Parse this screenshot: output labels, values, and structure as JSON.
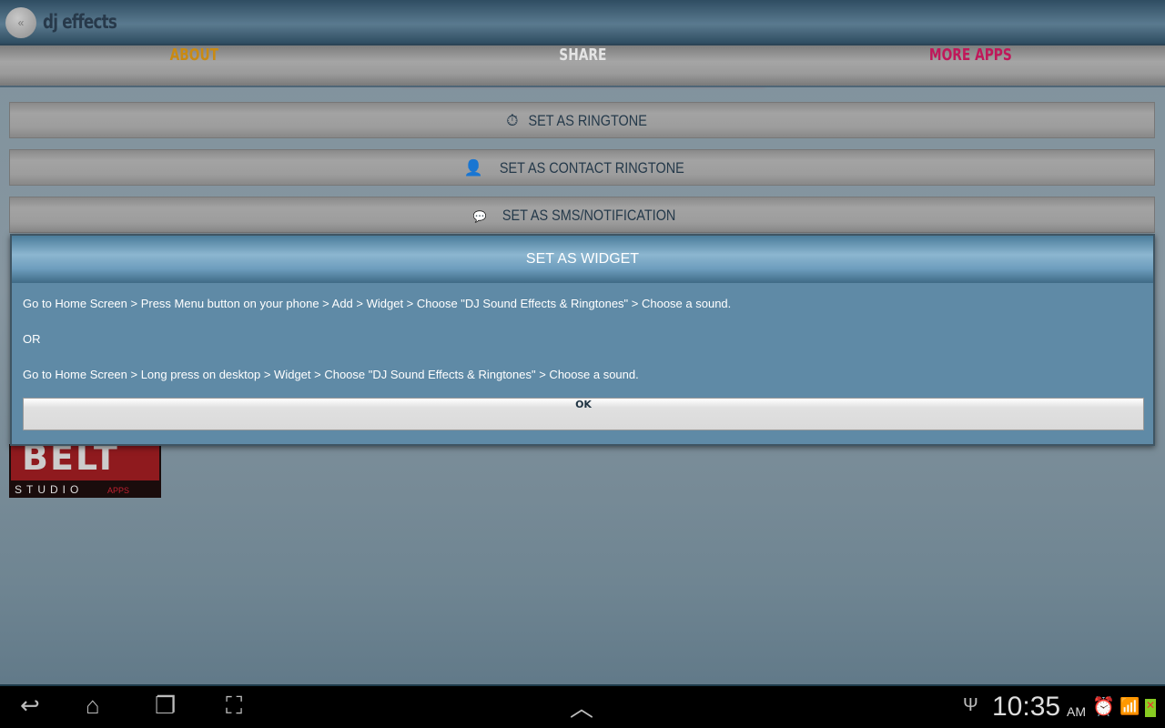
{
  "app": {
    "title": "dj effects"
  },
  "tabs": [
    {
      "label": "ABOUT",
      "color": "#c98a12"
    },
    {
      "label": "SHARE",
      "color": "#e4e4e4"
    },
    {
      "label": "MORE APPS",
      "color": "#c0185a"
    }
  ],
  "actions": [
    {
      "label": "SET AS RINGTONE",
      "icon": "stopwatch-icon"
    },
    {
      "label": "SET AS CONTACT RINGTONE",
      "icon": "person-icon"
    },
    {
      "label": "SET AS SMS/NOTIFICATION",
      "icon": "sms-icon"
    }
  ],
  "logo": {
    "text": "BELT",
    "sub": "STUDIO",
    "apps": "APPS"
  },
  "dialog": {
    "title": "SET AS WIDGET",
    "line1": "Go to Home Screen > Press Menu button on your phone > Add > Widget > Choose \"DJ Sound Effects & Ringtones\" > Choose a sound.",
    "line2": "OR",
    "line3": "Go to Home Screen > Long press on desktop > Widget > Choose \"DJ Sound Effects & Ringtones\" > Choose a sound.",
    "ok": "OK"
  },
  "status": {
    "time": "10:35",
    "ampm": "AM"
  }
}
